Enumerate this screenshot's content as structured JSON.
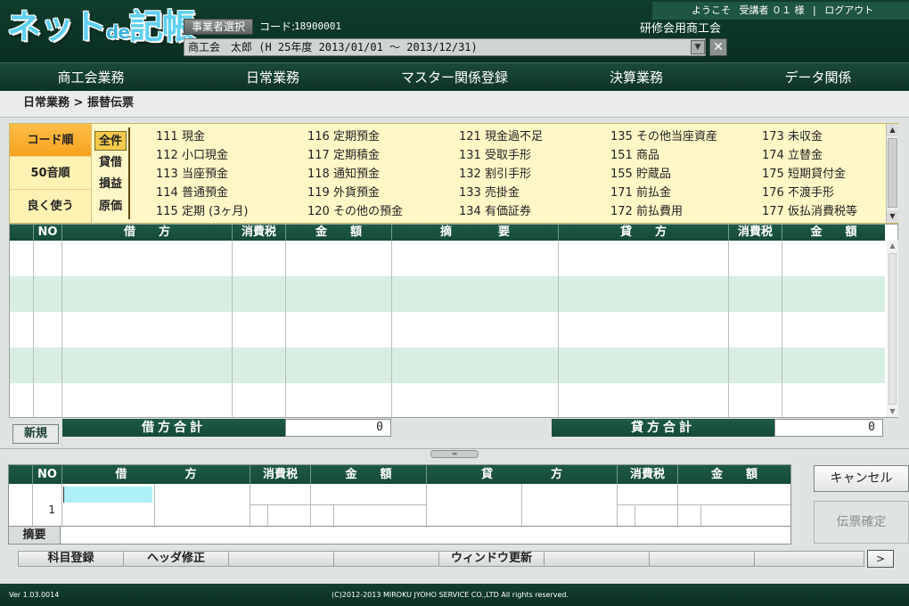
{
  "header": {
    "logo_text": "ネットde記帳",
    "select_business_label": "事業者選択",
    "code_label": "コード:",
    "code_value": "18900001",
    "company_combo_value": "商工会　太郎 (H 25年度 2013/01/01 ～ 2013/12/31)",
    "user_bar": {
      "welcome": "ようこそ",
      "user": "受講者 ０１ 様",
      "separator": "|",
      "logout": "ログアウト"
    },
    "org_name": "研修会用商工会"
  },
  "main_menu": [
    "商工会業務",
    "日常業務",
    "マスター関係登録",
    "決算業務",
    "データ関係"
  ],
  "breadcrumb": "日常業務 > 振替伝票",
  "picker": {
    "sort_tabs": [
      "コード順",
      "50音順",
      "良く使う"
    ],
    "active_sort": "コード順",
    "categories": [
      "全件",
      "貸借",
      "損益",
      "原価"
    ],
    "active_category": "全件",
    "accounts": [
      [
        "111 現金",
        "112 小口現金",
        "113 当座預金",
        "114 普通預金",
        "115 定期 (3ヶ月)"
      ],
      [
        "116 定期預金",
        "117 定期積金",
        "118 通知預金",
        "119 外貨預金",
        "120 その他の預金"
      ],
      [
        "121 現金過不足",
        "131 受取手形",
        "132 割引手形",
        "133 売掛金",
        "134 有価証券"
      ],
      [
        "135 その他当座資産",
        "151 商品",
        "155 貯蔵品",
        "171 前払金",
        "172 前払費用"
      ],
      [
        "173 未収金",
        "174 立替金",
        "175 短期貸付金",
        "176 不渡手形",
        "177 仮払消費税等"
      ]
    ]
  },
  "list": {
    "columns": [
      "NO",
      "借　　方",
      "消費税",
      "金　　額",
      "摘　　　　要",
      "貸　　方",
      "消費税",
      "金　　額"
    ]
  },
  "totals": {
    "new_button": "新規",
    "debit_label": "借方合計",
    "debit_value": "0",
    "credit_label": "貸方合計",
    "credit_value": "0"
  },
  "entry": {
    "columns": [
      "NO",
      "借　　　　　方",
      "消費税",
      "金　　額",
      "貸　　　　　方",
      "消費税",
      "金　　額"
    ],
    "row_no": "1",
    "summary_label": "摘要"
  },
  "side_buttons": {
    "cancel": "キャンセル",
    "confirm": "伝票確定"
  },
  "function_bar": {
    "items": [
      "科目登録",
      "ヘッダ修正",
      "",
      "",
      "ウィンドウ更新",
      "",
      "",
      ""
    ],
    "next": ">"
  },
  "footer": {
    "version": "Ver 1.03.0014",
    "copyright": "(C)2012-2013 MIROKU JYOHO SERVICE CO.,LTD All rights reserved."
  },
  "colors": {
    "header_bg": "#0b3526",
    "accent_green": "#1e5a45",
    "picker_bg": "#fff7c6",
    "active_tab": "#f7a21e",
    "row_alt": "#d8eee2",
    "input_highlight": "#aef0f7"
  }
}
